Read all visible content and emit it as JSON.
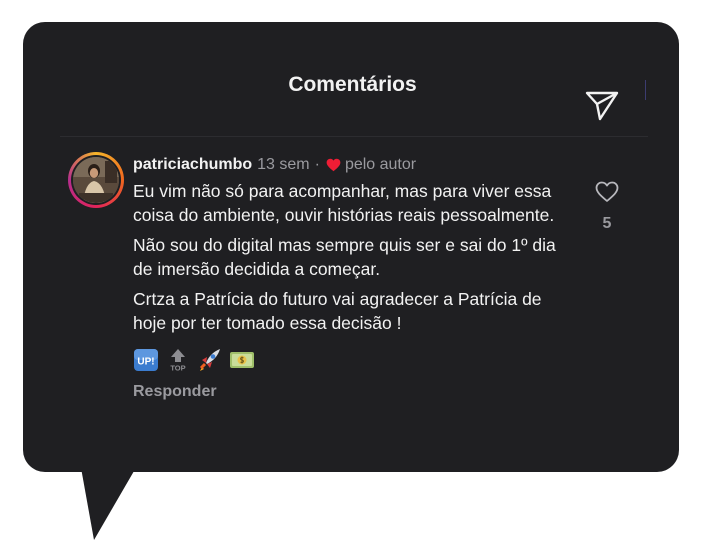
{
  "header": {
    "title": "Comentários",
    "action_icon": "paper-plane-icon"
  },
  "comment": {
    "username": "patriciachumbo",
    "time": "13 sem",
    "separator": "·",
    "liked_by_author_icon": "red-heart-icon",
    "liked_by_author": "pelo autor",
    "paragraphs": [
      "Eu vim não só para acompanhar, mas para viver essa coisa do ambiente, ouvir histórias reais pessoalmente.",
      "Não sou do digital mas sempre quis ser e sai do 1º dia de imersão decidida a começar.",
      "Crtza a Patrícia do futuro vai agradecer a Patrícia de hoje por ter tomado essa decisão !"
    ],
    "emojis": {
      "up": "UP!",
      "top": "TOP",
      "rocket": "rocket-emoji",
      "money": "money-emoji"
    },
    "reply_label": "Responder",
    "like_icon": "heart-outline-icon",
    "like_count": "5"
  },
  "colors": {
    "background": "#1f1f22",
    "text_primary": "#f2f2f2",
    "text_secondary": "#9a9a9f",
    "heart": "#ee1d35",
    "emoji_blue": "#3b7ccf"
  }
}
